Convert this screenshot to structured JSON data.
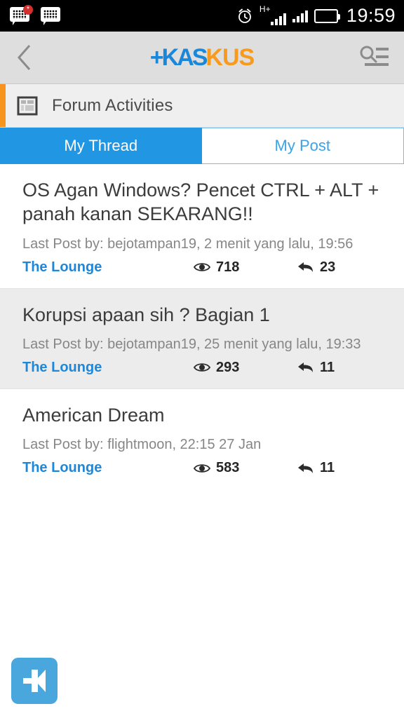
{
  "statusbar": {
    "icons": [
      "bbm-message-icon-badged",
      "bbm-message-icon",
      "alarm-icon",
      "signal-hplus-icon",
      "signal-icon",
      "battery-icon"
    ],
    "network_label": "H+",
    "badge": "*",
    "time": "19:59",
    "battery_color": "#53d317"
  },
  "appbar": {
    "back_icon": "chevron-left-icon",
    "logo_part1": "+KAS",
    "logo_part2": "KUS",
    "logo_color1": "#1b87d8",
    "logo_color2": "#f89a1c",
    "search_icon": "search-list-icon"
  },
  "section": {
    "icon": "forum-article-icon",
    "title": "Forum Activities",
    "accent_color": "#f7941d"
  },
  "tabs": [
    {
      "label": "My Thread",
      "active": true
    },
    {
      "label": "My Post",
      "active": false
    }
  ],
  "threads": [
    {
      "title": "OS Agan Windows? Pencet CTRL + ALT + panah kanan SEKARANG!!",
      "meta": "Last Post by: bejotampan19, 2 menit yang lalu, 19:56",
      "forum": "The Lounge",
      "views": "718",
      "replies": "23"
    },
    {
      "title": "Korupsi apaan sih ? Bagian 1",
      "meta": "Last Post by: bejotampan19, 25 menit yang lalu, 19:33",
      "forum": "The Lounge",
      "views": "293",
      "replies": "11"
    },
    {
      "title": "American Dream",
      "meta": "Last Post by: flightmoon, 22:15 27 Jan",
      "forum": "The Lounge",
      "views": "583",
      "replies": "11"
    }
  ],
  "fab": {
    "icon": "kaskus-k-icon",
    "color": "#4aa7dd"
  }
}
